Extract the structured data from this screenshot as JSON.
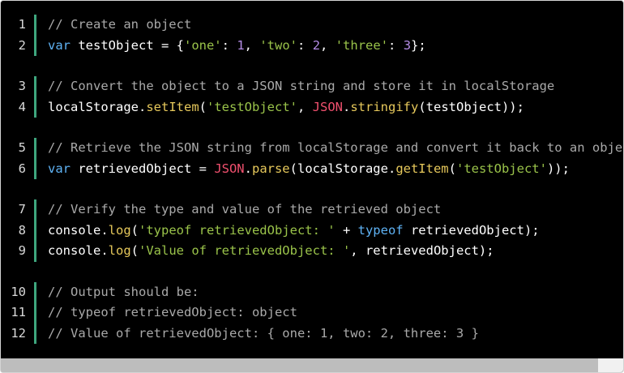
{
  "code_lines": [
    {
      "n": "1",
      "tokens": [
        {
          "t": "// Create an object",
          "k": "comment"
        }
      ]
    },
    {
      "n": "2",
      "tokens": [
        {
          "t": "var",
          "k": "kw"
        },
        {
          "t": " testObject = {",
          "k": "var"
        },
        {
          "t": "'one'",
          "k": "str"
        },
        {
          "t": ": ",
          "k": "punc"
        },
        {
          "t": "1",
          "k": "num"
        },
        {
          "t": ", ",
          "k": "punc"
        },
        {
          "t": "'two'",
          "k": "str"
        },
        {
          "t": ": ",
          "k": "punc"
        },
        {
          "t": "2",
          "k": "num"
        },
        {
          "t": ", ",
          "k": "punc"
        },
        {
          "t": "'three'",
          "k": "str"
        },
        {
          "t": ": ",
          "k": "punc"
        },
        {
          "t": "3",
          "k": "num"
        },
        {
          "t": "};",
          "k": "punc"
        }
      ]
    },
    {
      "n": "3",
      "tokens": [
        {
          "t": "// Convert the object to a JSON string and store it in localStorage",
          "k": "comment"
        }
      ]
    },
    {
      "n": "4",
      "tokens": [
        {
          "t": "localStorage.",
          "k": "var"
        },
        {
          "t": "setItem",
          "k": "fn"
        },
        {
          "t": "(",
          "k": "punc"
        },
        {
          "t": "'testObject'",
          "k": "str"
        },
        {
          "t": ", ",
          "k": "punc"
        },
        {
          "t": "JSON",
          "k": "obj"
        },
        {
          "t": ".",
          "k": "punc"
        },
        {
          "t": "stringify",
          "k": "fn"
        },
        {
          "t": "(testObject));",
          "k": "var"
        }
      ]
    },
    {
      "n": "5",
      "tokens": [
        {
          "t": "// Retrieve the JSON string from localStorage and convert it back to an object",
          "k": "comment"
        }
      ]
    },
    {
      "n": "6",
      "tokens": [
        {
          "t": "var",
          "k": "kw"
        },
        {
          "t": " retrievedObject = ",
          "k": "var"
        },
        {
          "t": "JSON",
          "k": "obj"
        },
        {
          "t": ".",
          "k": "punc"
        },
        {
          "t": "parse",
          "k": "fn"
        },
        {
          "t": "(localStorage.",
          "k": "var"
        },
        {
          "t": "getItem",
          "k": "fn"
        },
        {
          "t": "(",
          "k": "punc"
        },
        {
          "t": "'testObject'",
          "k": "str"
        },
        {
          "t": "));",
          "k": "punc"
        }
      ]
    },
    {
      "n": "7",
      "tokens": [
        {
          "t": "// Verify the type and value of the retrieved object",
          "k": "comment"
        }
      ]
    },
    {
      "n": "8",
      "tokens": [
        {
          "t": "console.",
          "k": "var"
        },
        {
          "t": "log",
          "k": "fn"
        },
        {
          "t": "(",
          "k": "punc"
        },
        {
          "t": "'typeof retrievedObject: '",
          "k": "str"
        },
        {
          "t": " + ",
          "k": "punc"
        },
        {
          "t": "typeof",
          "k": "kw"
        },
        {
          "t": " retrievedObject);",
          "k": "var"
        }
      ]
    },
    {
      "n": "9",
      "tokens": [
        {
          "t": "console.",
          "k": "var"
        },
        {
          "t": "log",
          "k": "fn"
        },
        {
          "t": "(",
          "k": "punc"
        },
        {
          "t": "'Value of retrievedObject: '",
          "k": "str"
        },
        {
          "t": ", retrievedObject);",
          "k": "var"
        }
      ]
    },
    {
      "n": "10",
      "tokens": [
        {
          "t": "// Output should be:",
          "k": "comment"
        }
      ]
    },
    {
      "n": "11",
      "tokens": [
        {
          "t": "// typeof retrievedObject: object",
          "k": "comment"
        }
      ]
    },
    {
      "n": "12",
      "tokens": [
        {
          "t": "// Value of retrievedObject: { one: 1, two: 2, three: 3 }",
          "k": "comment"
        }
      ]
    }
  ],
  "groups": [
    [
      0,
      1
    ],
    [
      2,
      3
    ],
    [
      4,
      5
    ],
    [
      6,
      7,
      8
    ],
    [
      9,
      10,
      11
    ]
  ],
  "colors": {
    "background": "#000000",
    "comment": "#a9a9a9",
    "keyword": "#5fb3f5",
    "string": "#9ac34a",
    "number": "#b48ce6",
    "function": "#e6c85b",
    "builtin_object": "#f0506e",
    "gutter_bar": "#3ea67e"
  }
}
